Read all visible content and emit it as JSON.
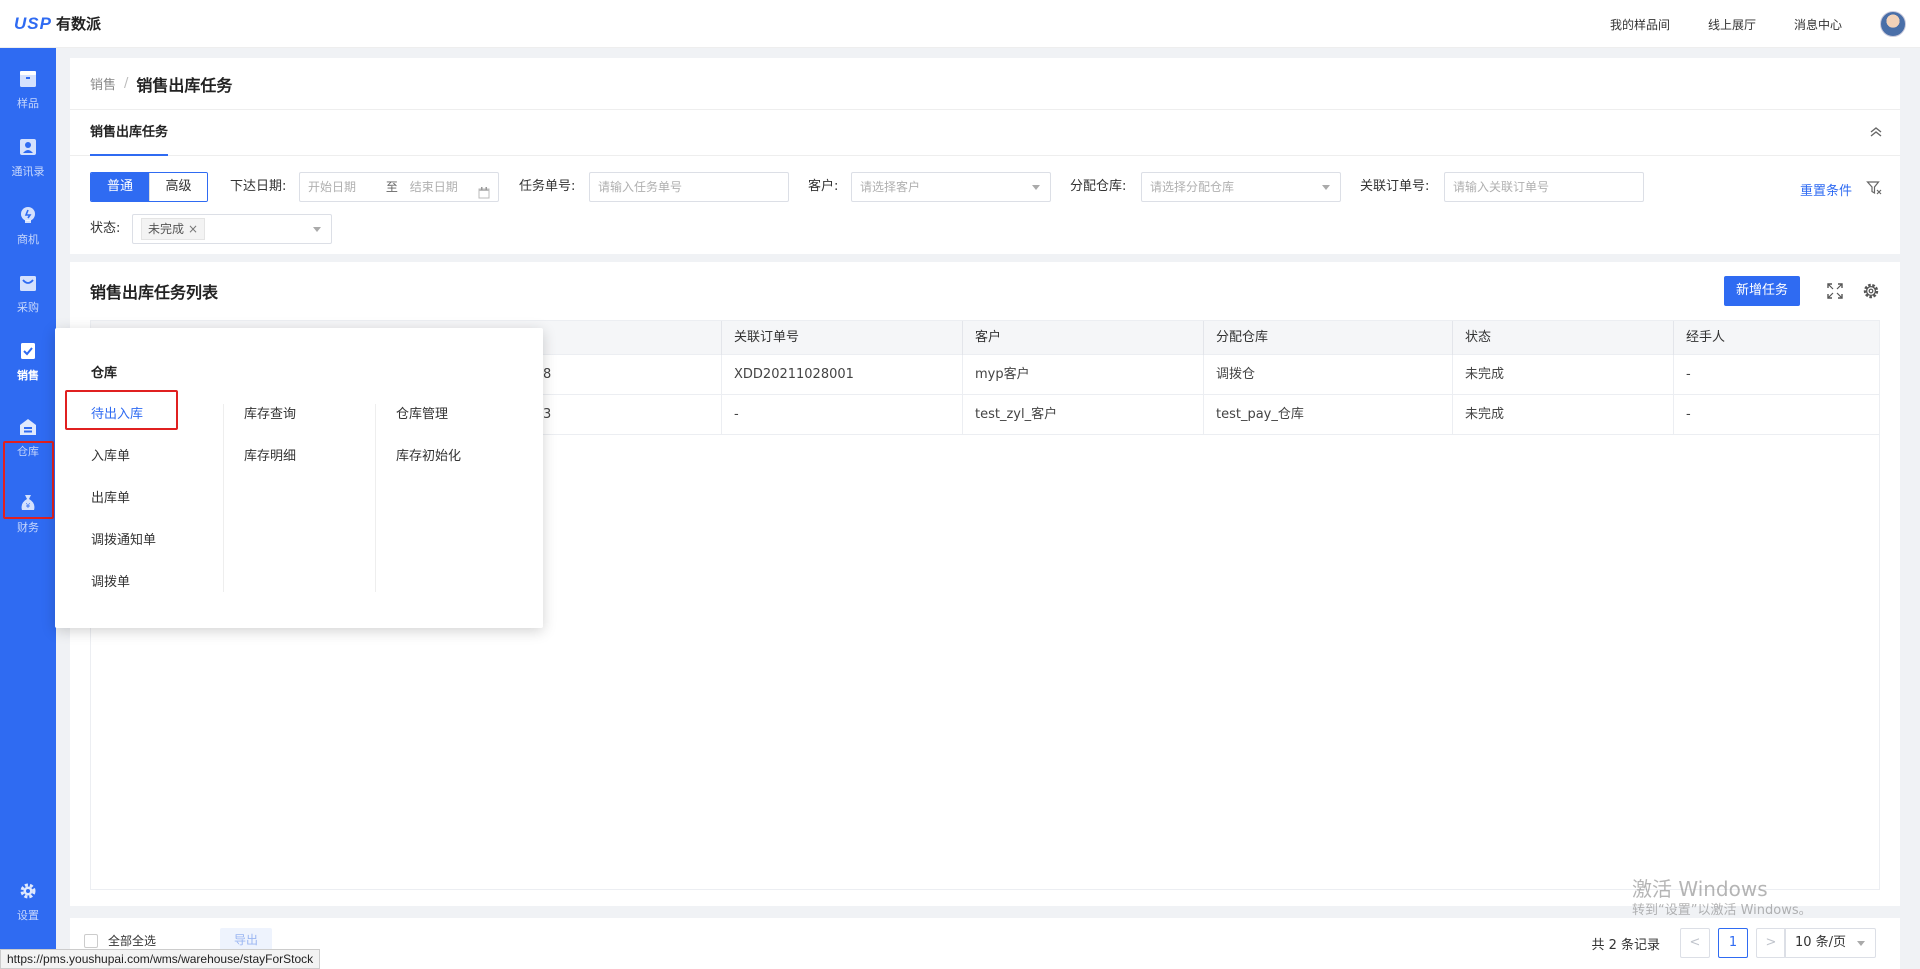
{
  "header": {
    "logo_mark": "USP",
    "logo_text": "有数派",
    "links": [
      "我的样品间",
      "线上展厅",
      "消息中心"
    ]
  },
  "sidebar": {
    "items": [
      {
        "label": "样品",
        "icon": "box-icon",
        "active": false
      },
      {
        "label": "通讯录",
        "icon": "contacts-icon",
        "active": false
      },
      {
        "label": "商机",
        "icon": "bulb-icon",
        "active": false
      },
      {
        "label": "采购",
        "icon": "cart-icon",
        "active": false
      },
      {
        "label": "销售",
        "icon": "clipboard-check-icon",
        "active": true
      },
      {
        "label": "仓库",
        "icon": "warehouse-icon",
        "active": false
      },
      {
        "label": "财务",
        "icon": "money-bag-icon",
        "active": false
      }
    ],
    "settings_label": "设置"
  },
  "breadcrumb": {
    "parent": "销售",
    "separator": "/",
    "current": "销售出库任务"
  },
  "tab": {
    "label": "销售出库任务"
  },
  "filters": {
    "mode_normal": "普通",
    "mode_advanced": "高级",
    "date_label": "下达日期:",
    "date_start_placeholder": "开始日期",
    "date_to": "至",
    "date_end_placeholder": "结束日期",
    "task_no_label": "任务单号:",
    "task_no_placeholder": "请输入任务单号",
    "customer_label": "客户:",
    "customer_placeholder": "请选择客户",
    "warehouse_label": "分配仓库:",
    "warehouse_placeholder": "请选择分配仓库",
    "order_no_label": "关联订单号:",
    "order_no_placeholder": "请输入关联订单号",
    "status_label": "状态:",
    "status_tag": "未完成",
    "reset_label": "重置条件"
  },
  "list": {
    "title": "销售出库任务列表",
    "add_button": "新增任务",
    "columns": [
      "关联订单号",
      "客户",
      "分配仓库",
      "状态",
      "经手人"
    ],
    "rows": [
      {
        "task_tail": "8",
        "order_no": "XDD20211028001",
        "customer": "myp客户",
        "warehouse": "调拨仓",
        "status": "未完成",
        "handler": "-"
      },
      {
        "task_tail": "3",
        "order_no": "-",
        "customer": "test_zyl_客户",
        "warehouse": "test_pay_仓库",
        "status": "未完成",
        "handler": "-"
      }
    ]
  },
  "footer": {
    "select_all": "全部全选",
    "export": "导出",
    "total": "共 2 条记录",
    "page_prev": "<",
    "page_current": "1",
    "page_next": ">",
    "page_size": "10 条/页"
  },
  "flyout": {
    "title": "仓库",
    "col1": [
      "待出入库",
      "入库单",
      "出库单",
      "调拨通知单",
      "调拨单"
    ],
    "col2": [
      "库存查询",
      "库存明细"
    ],
    "col3": [
      "仓库管理",
      "库存初始化"
    ]
  },
  "watermark": {
    "line1": "激活 Windows",
    "line2": "转到“设置”以激活 Windows。"
  },
  "status_url": "https://pms.youshupai.com/wms/warehouse/stayForStock",
  "colors": {
    "accent": "#2f6bf2",
    "highlight": "#e02020"
  }
}
